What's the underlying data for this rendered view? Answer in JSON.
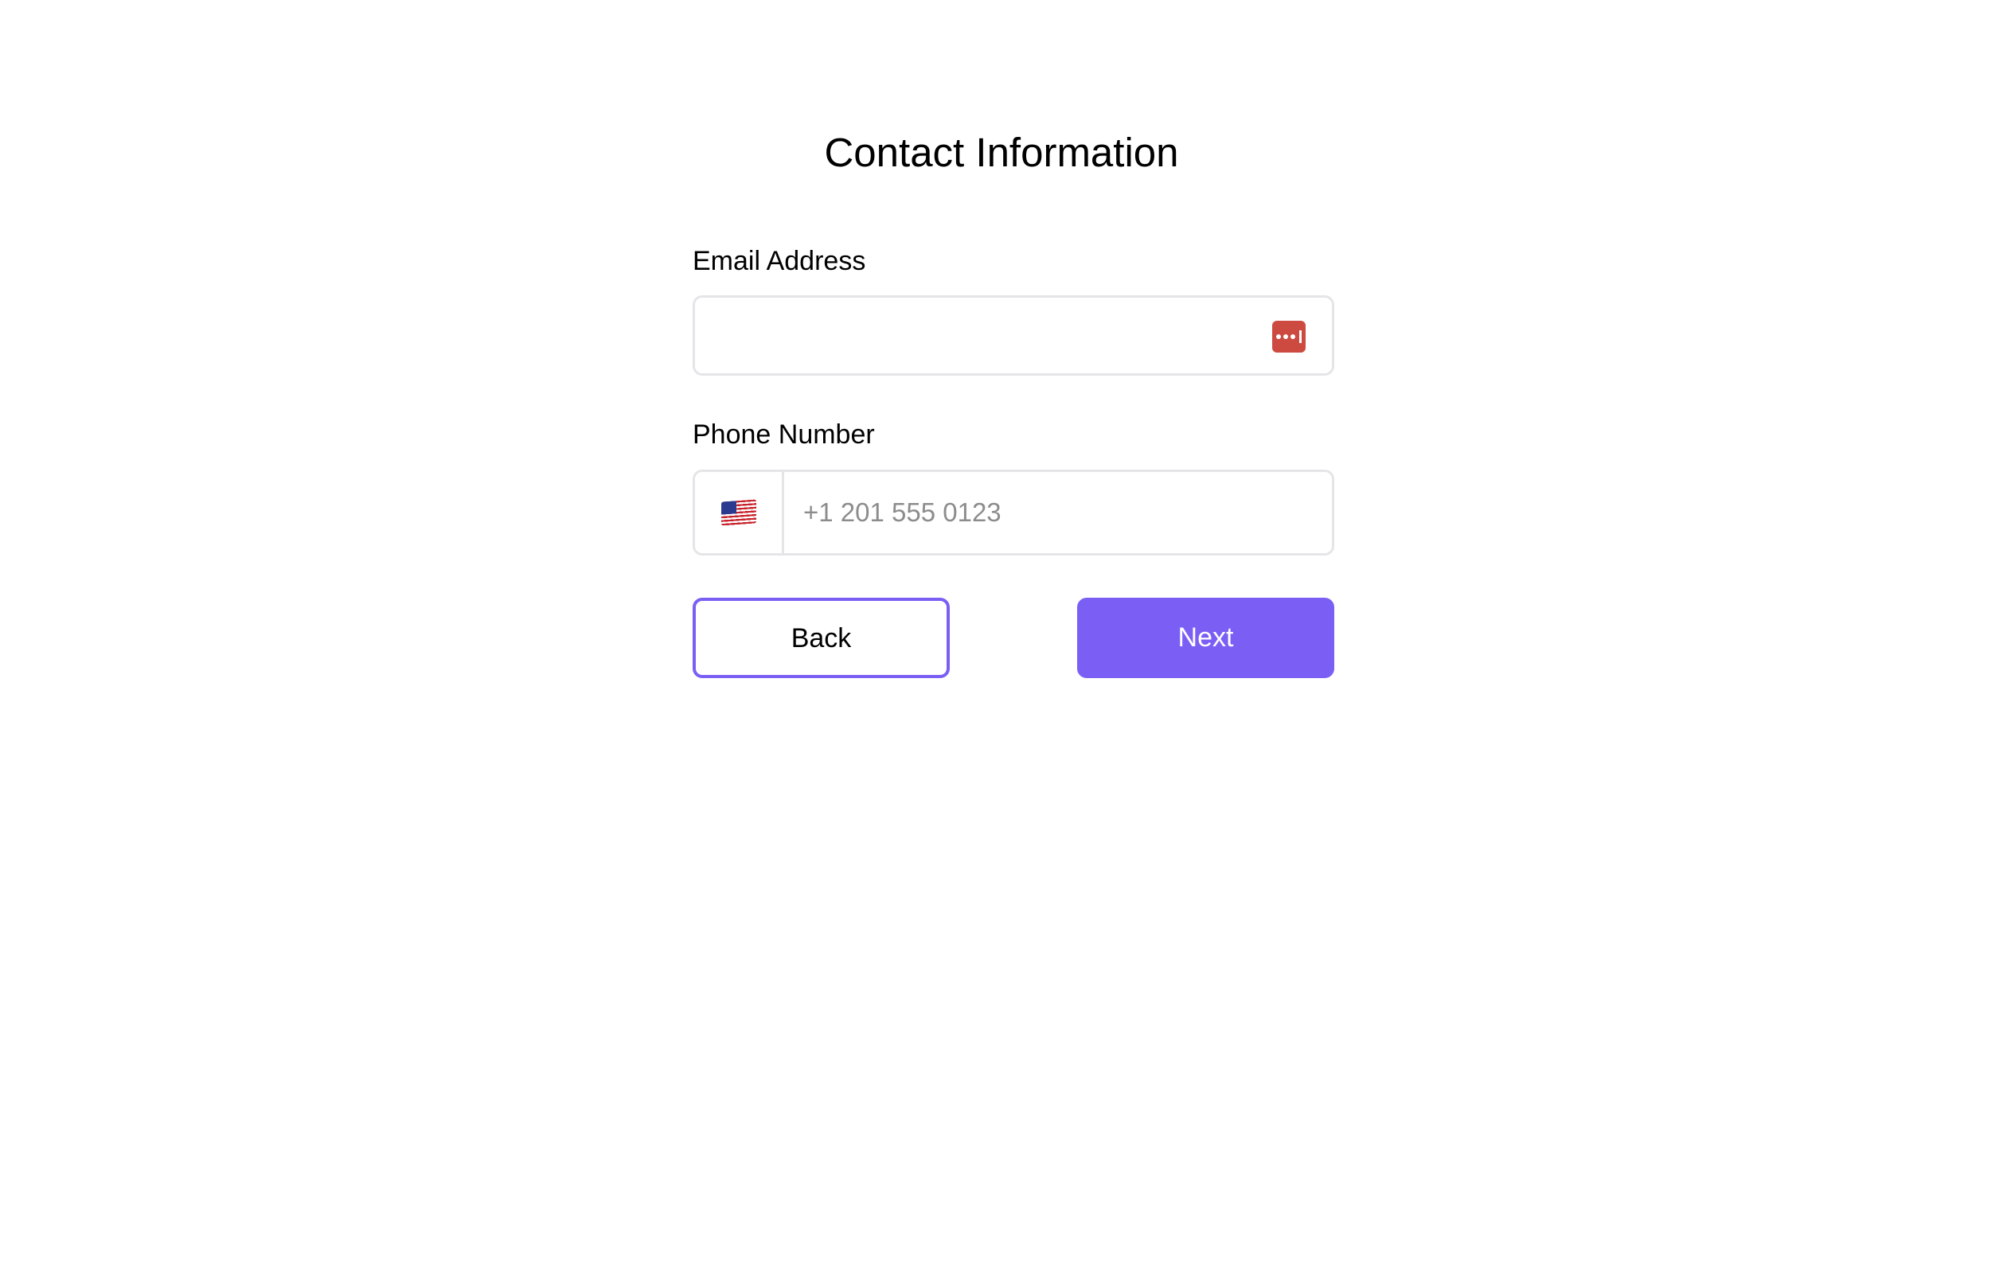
{
  "form": {
    "title": "Contact Information",
    "email": {
      "label": "Email Address",
      "value": "",
      "placeholder": "",
      "autofill_icon": "password-manager-icon"
    },
    "phone": {
      "label": "Phone Number",
      "value": "",
      "placeholder": "+1 201 555 0123",
      "country_icon": "us-flag-icon"
    },
    "buttons": {
      "back_label": "Back",
      "next_label": "Next"
    }
  },
  "colors": {
    "accent": "#7b5ff5",
    "password_manager_icon": "#cc4a40",
    "field_border": "#e5e5e8"
  }
}
